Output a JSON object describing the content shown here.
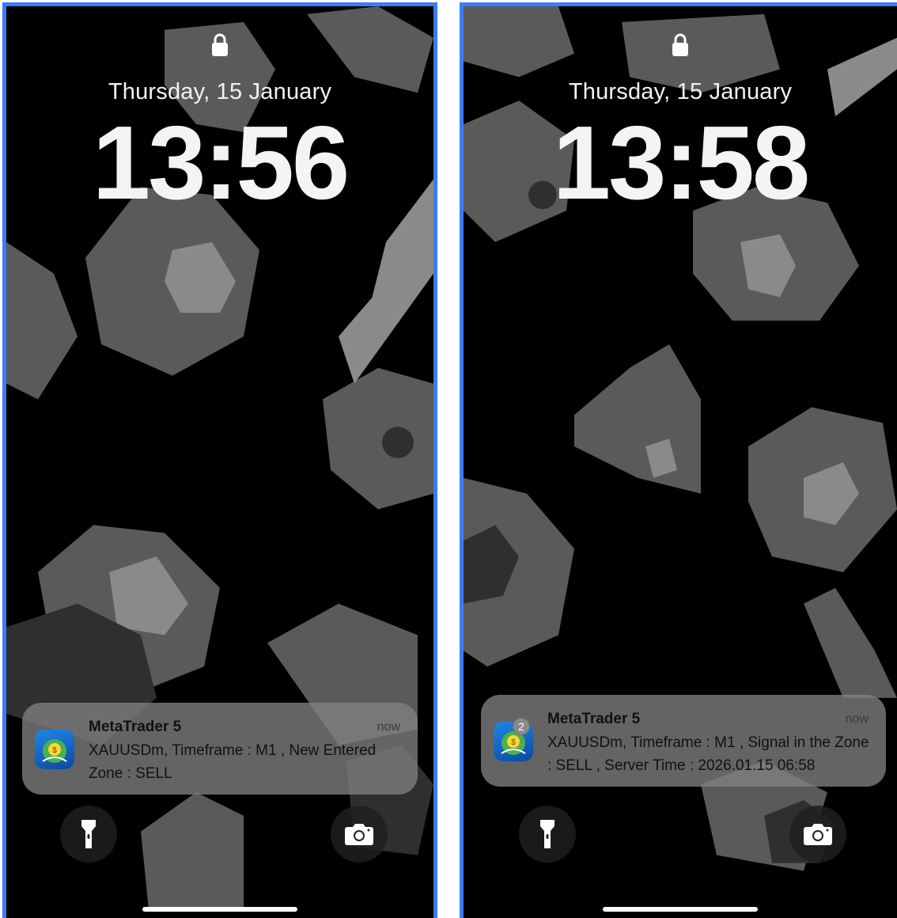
{
  "screens": [
    {
      "date": "Thursday, 15 January",
      "time": "13:56",
      "notification": {
        "app": "MetaTrader 5",
        "when": "now",
        "body": "XAUUSDm, Timeframe : M1 , New Entered Zone : SELL",
        "badge": ""
      }
    },
    {
      "date": "Thursday, 15 January",
      "time": "13:58",
      "notification": {
        "app": "MetaTrader 5",
        "when": "now",
        "body": "XAUUSDm, Timeframe : M1 , Signal in the Zone : SELL , Server Time : 2026.01.15 06:58",
        "badge": "2"
      }
    }
  ],
  "icons": {
    "lock": "lock-icon",
    "flashlight": "flashlight-icon",
    "camera": "camera-icon",
    "app": "metatrader-app-icon"
  },
  "colors": {
    "frame": "#3b7cf2",
    "wallpaper_bg": "#000000",
    "flower_light": "#8c8c8c",
    "flower_mid": "#5e5e5e",
    "flower_dark": "#3a3a3a"
  }
}
